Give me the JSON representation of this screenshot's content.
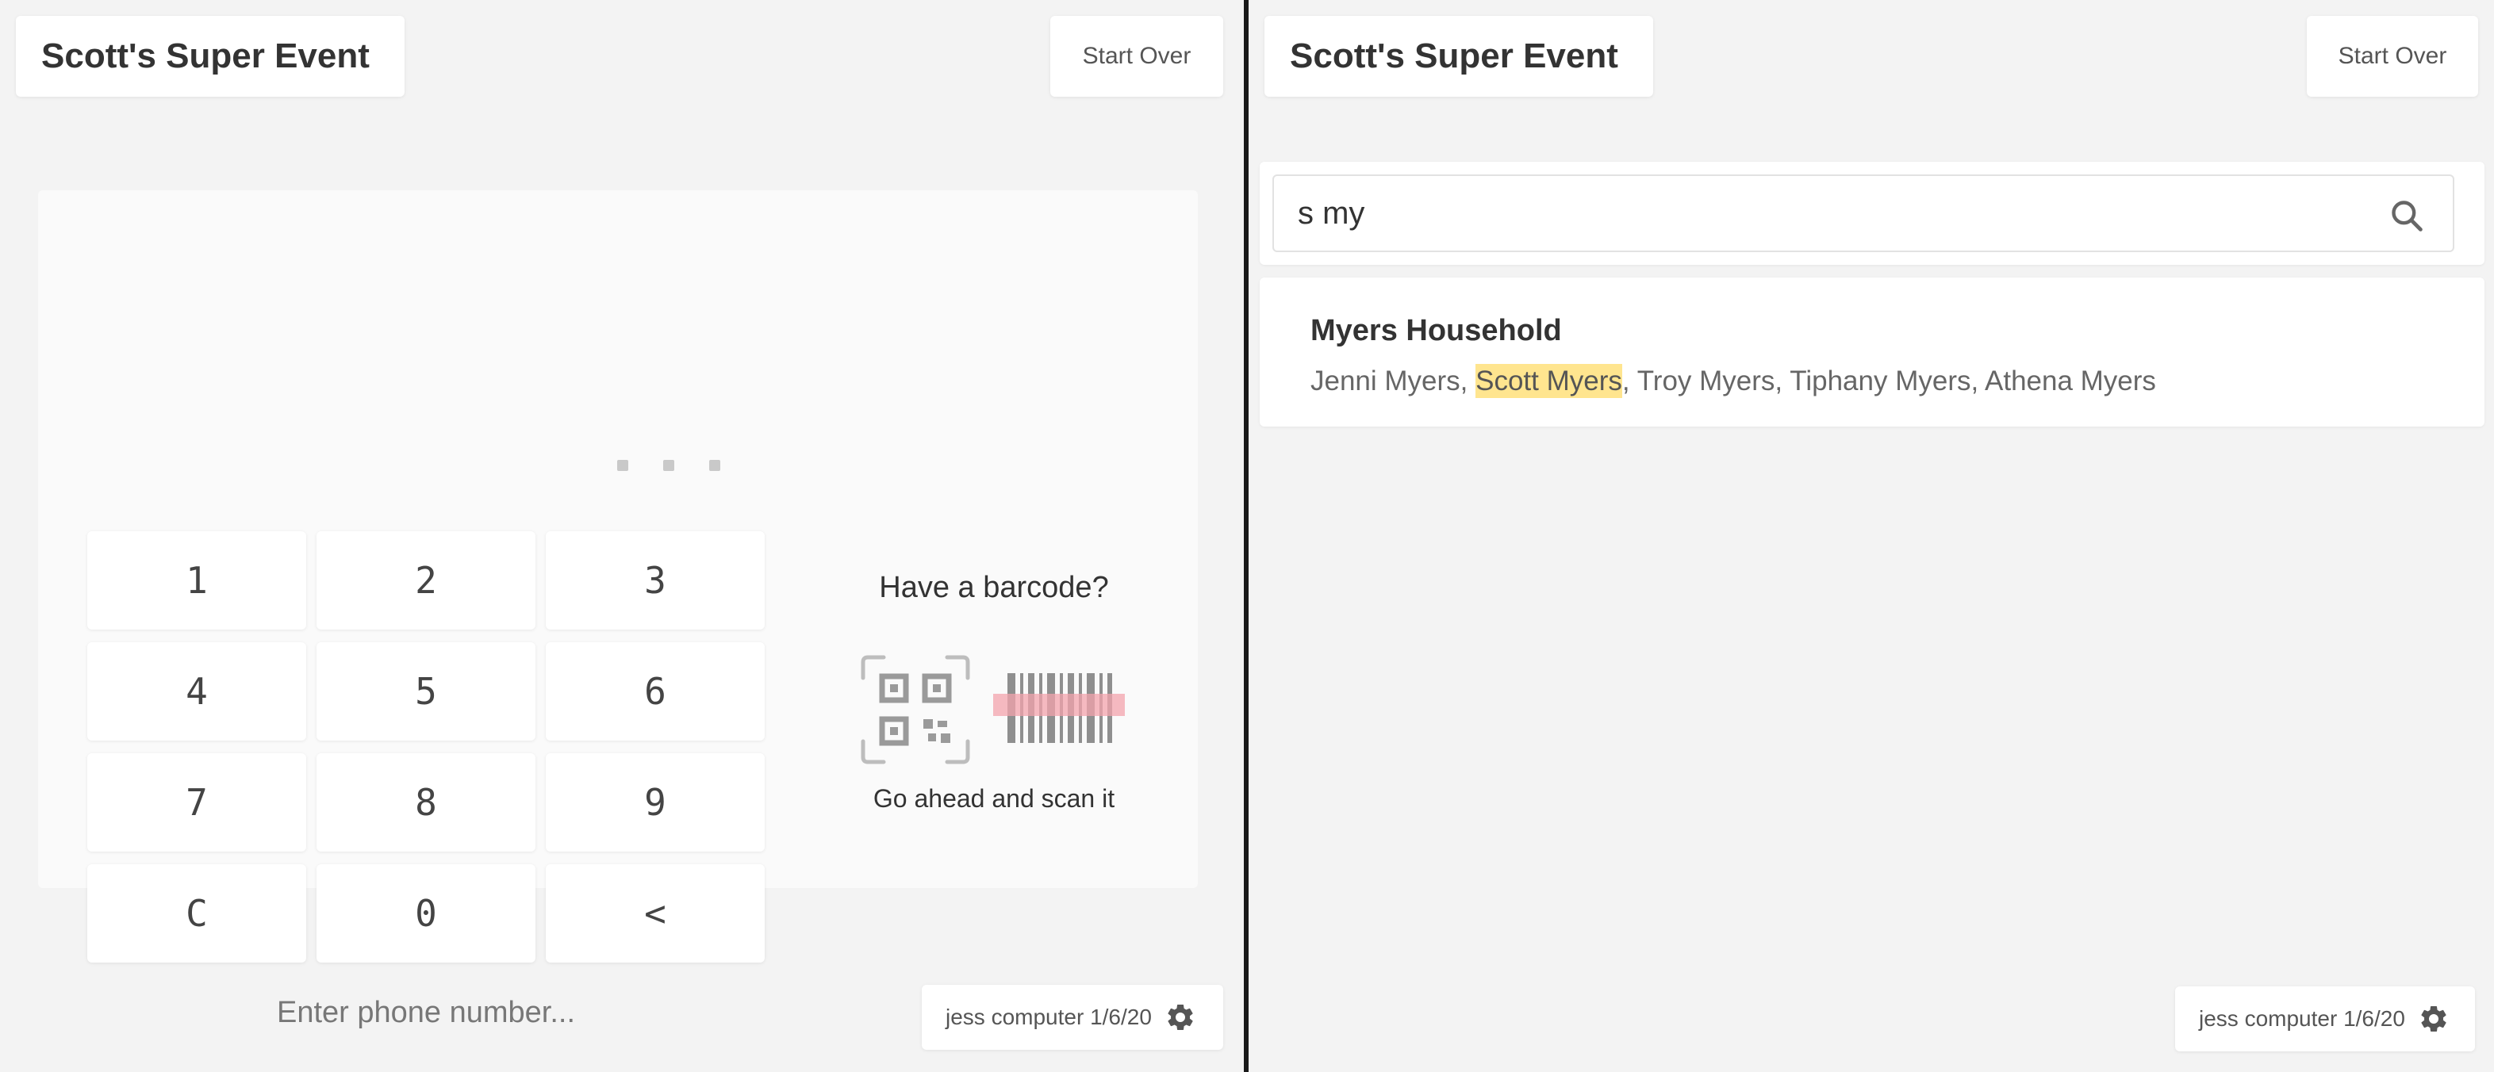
{
  "left": {
    "title": "Scott's Super Event",
    "start_over": "Start Over",
    "keypad": [
      "1",
      "2",
      "3",
      "4",
      "5",
      "6",
      "7",
      "8",
      "9",
      "C",
      "0",
      "<"
    ],
    "phone_placeholder": "Enter phone number...",
    "barcode": {
      "heading": "Have a barcode?",
      "subtext": "Go ahead and scan it"
    },
    "footer": {
      "label": "jess computer 1/6/20",
      "icon": "gear-icon"
    }
  },
  "right": {
    "title": "Scott's Super Event",
    "start_over": "Start Over",
    "search": {
      "value": "s my",
      "icon": "search-icon"
    },
    "results": [
      {
        "household": "Myers Household",
        "members": [
          {
            "name": "Jenni Myers",
            "highlight": false
          },
          {
            "name": "Scott Myers",
            "highlight": true
          },
          {
            "name": "Troy Myers",
            "highlight": false
          },
          {
            "name": "Tiphany Myers",
            "highlight": false
          },
          {
            "name": "Athena Myers",
            "highlight": false
          }
        ]
      }
    ],
    "footer": {
      "label": "jess computer 1/6/20",
      "icon": "gear-icon"
    }
  },
  "colors": {
    "background": "#f3f3f3",
    "highlight": "#ffe58f",
    "scan_line": "#f3a3ac"
  }
}
